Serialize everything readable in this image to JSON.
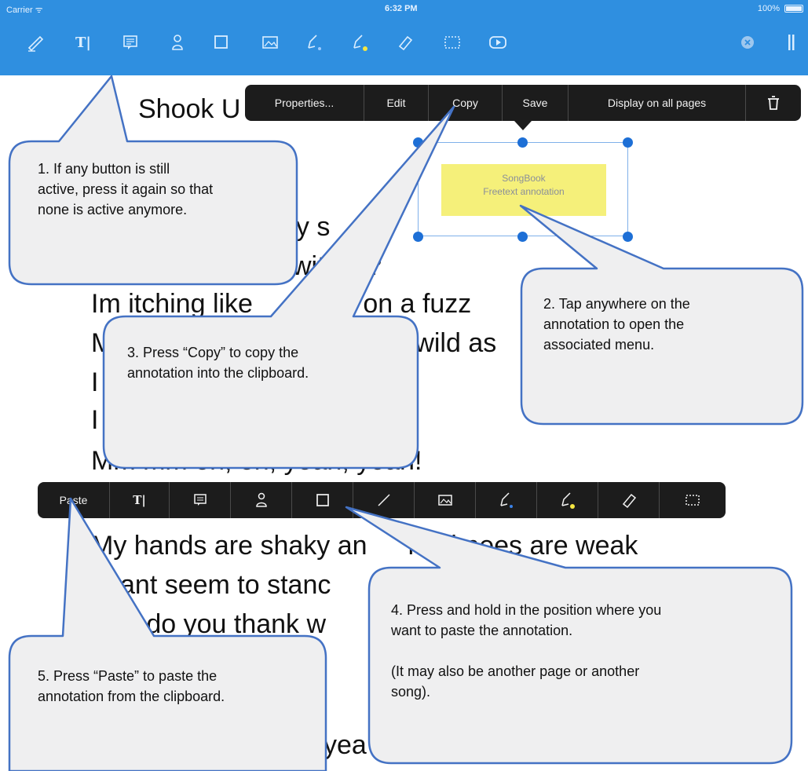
{
  "status_bar": {
    "carrier": "Carrier ᯤ",
    "time": "6:32 PM",
    "battery": "100%"
  },
  "toolbar": {
    "tools": [
      {
        "name": "pen-tool-icon"
      },
      {
        "name": "text-tool-icon",
        "label": "T|"
      },
      {
        "name": "note-tool-icon"
      },
      {
        "name": "stamp-tool-icon"
      },
      {
        "name": "rectangle-tool-icon"
      },
      {
        "name": "image-tool-icon"
      },
      {
        "name": "pencil-blue-icon"
      },
      {
        "name": "highlighter-yellow-icon"
      },
      {
        "name": "eraser-icon"
      },
      {
        "name": "selection-rect-icon"
      },
      {
        "name": "play-icon"
      },
      {
        "name": "close-circle-icon"
      },
      {
        "name": "more-icon"
      }
    ]
  },
  "song": {
    "title_visible": "Shook U",
    "lines": [
      {
        "text": "ny s"
      },
      {
        "text": "with",
        "suffix": "e?"
      },
      {
        "text": "Im itching like",
        "tail": "n on a fuzz"
      },
      {
        "text": "M",
        "tail": "wild as"
      },
      {
        "text": "I"
      },
      {
        "text": "I"
      },
      {
        "text": "Mm mm oh, oh, yeah, yeah!"
      },
      {
        "text": "My hands are shaky an",
        "tail": "my knees are weak"
      },
      {
        "text": "cant seem to stanc"
      },
      {
        "text": "o do you thank w"
      },
      {
        "text": "yea"
      }
    ]
  },
  "annotation_menu": {
    "items": [
      "Properties...",
      "Edit",
      "Copy",
      "Save",
      "Display on all pages"
    ],
    "trash_icon": "trash-icon"
  },
  "annotation": {
    "line1": "SongBook",
    "line2": "Freetext annotation"
  },
  "paste_menu": {
    "paste_label": "Paste",
    "text_tool_label": "T|",
    "icons": [
      "note-icon",
      "stamp-icon",
      "rectangle-icon",
      "line-icon",
      "image-icon",
      "pencil-blue-icon",
      "highlighter-yellow-icon",
      "eraser-icon",
      "selection-rect-icon"
    ]
  },
  "callouts": [
    {
      "id": 1,
      "text": "1. If any button is still\nactive, press it again so that\nnone is active anymore."
    },
    {
      "id": 2,
      "text": "2. Tap anywhere on the\nannotation to open the\nassociated menu."
    },
    {
      "id": 3,
      "text": "3. Press “Copy” to copy the\nannotation into the clipboard."
    },
    {
      "id": 4,
      "text": "4. Press and hold in the position where you\nwant to paste the annotation.\n\n(It may also be another page or another\nsong)."
    },
    {
      "id": 5,
      "text": "5. Press “Paste” to paste the\nannotation from the clipboard."
    }
  ],
  "colors": {
    "toolbar": "#2f8fe0",
    "menu": "#1c1c1c",
    "callout_fill": "#efeff0",
    "callout_stroke": "#4472c4",
    "annotation_fill": "#f5f07a",
    "handle": "#1d6fd6"
  }
}
